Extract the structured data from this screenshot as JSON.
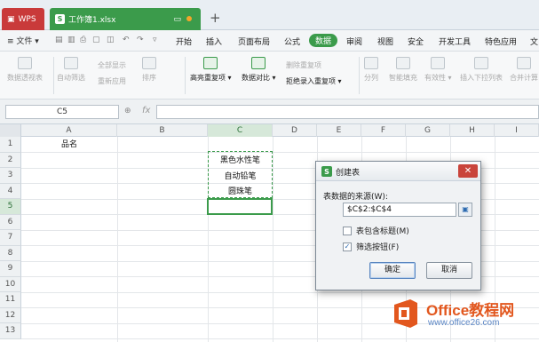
{
  "titlebar": {
    "wps_tab": "WPS",
    "file_tab": "工作簿1.xlsx",
    "new_tab": "+"
  },
  "menubar": {
    "file_menu": "≡ 文件 ▾",
    "items": [
      "开始",
      "插入",
      "页面布局",
      "公式",
      "数据",
      "审阅",
      "视图",
      "安全",
      "开发工具",
      "特色应用",
      "文"
    ],
    "active_item": "数据"
  },
  "ribbon": {
    "pivot": "数据透视表",
    "autofilter": "自动筛选",
    "show_all": "全部显示",
    "reapply": "重新应用",
    "sort": "排序",
    "highlight_dup": "高亮重复项 ▾",
    "compare": "数据对比 ▾",
    "delete_dup": "删除重复项",
    "reject_dup": "拒绝录入重复项 ▾",
    "split": "分列",
    "smart_fill": "智能填充",
    "validity": "有效性 ▾",
    "dropdown_list": "插入下拉列表",
    "merge_calc": "合并计算"
  },
  "formula_bar": {
    "name_box": "C5",
    "fx": "fx",
    "zoom_icon": "⊕"
  },
  "grid": {
    "columns": [
      "A",
      "B",
      "C",
      "D",
      "E",
      "F",
      "G",
      "H",
      "I"
    ],
    "rows": [
      "1",
      "2",
      "3",
      "4",
      "5",
      "6",
      "7",
      "8",
      "9",
      "10",
      "11",
      "12",
      "13"
    ],
    "a1": "品名",
    "c2": "黑色水性笔",
    "c3": "自动铅笔",
    "c4": "圆珠笔"
  },
  "dialog": {
    "title": "创建表",
    "source_label": "表数据的来源(W):",
    "source_value": "$C$2:$C$4",
    "has_header": "表包含标题(M)",
    "has_header_checked": false,
    "filter_button": "筛选按钮(F)",
    "filter_button_checked": true,
    "ok": "确定",
    "cancel": "取消",
    "close_glyph": "✕"
  },
  "watermark": {
    "title": "Office教程网",
    "url": "www.office26.com"
  },
  "colors": {
    "accent_green": "#3b9b4b",
    "wps_red": "#c93a3a",
    "watermark_orange": "#e2571e"
  }
}
